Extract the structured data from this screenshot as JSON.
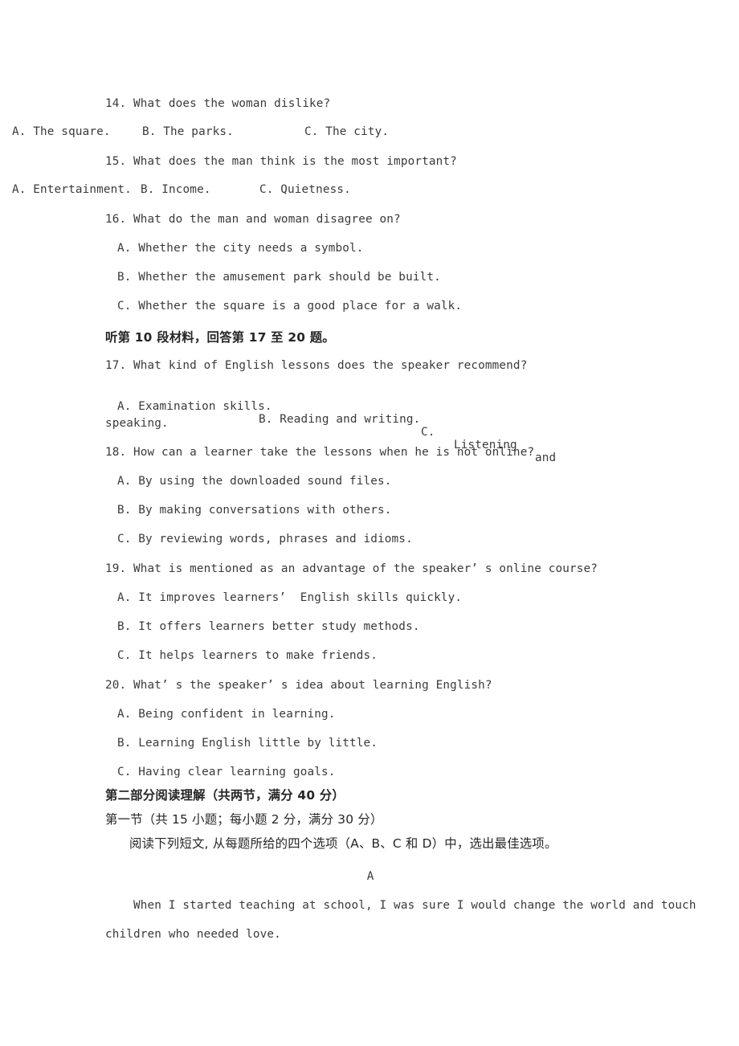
{
  "document": {
    "kind": "exam-paper-page",
    "language_mix": "english-with-chinese-headings",
    "text_color": "#3a3a3a",
    "background_color": "#ffffff"
  },
  "listening": {
    "q14": {
      "stem": "14. What does the woman dislike?",
      "options": [
        {
          "key": "A.",
          "text": "The square."
        },
        {
          "key": "B.",
          "text": "The parks."
        },
        {
          "key": "C.",
          "text": "The city."
        }
      ]
    },
    "q15": {
      "stem": "15. What does the man think is the most important?",
      "options": [
        {
          "key": "A.",
          "text": "Entertainment."
        },
        {
          "key": "B.",
          "text": "Income."
        },
        {
          "key": "C.",
          "text": "Quietness."
        }
      ]
    },
    "q16": {
      "stem": "16. What do the man and woman disagree on?",
      "options": [
        {
          "key": "A.",
          "text": "Whether the city needs a symbol."
        },
        {
          "key": "B.",
          "text": "Whether the amusement park should be built."
        },
        {
          "key": "C.",
          "text": "Whether the square is a good place for a walk."
        }
      ]
    },
    "material10_heading": "听第 10 段材料，回答第 17 至 20 题。",
    "q17": {
      "stem": "17. What kind of English lessons does the speaker recommend?",
      "option_a": "A. Examination skills.",
      "option_b": "B. Reading and writing.",
      "option_c_head": "C.",
      "option_c_word1": "Listening",
      "option_c_word2": "and",
      "option_c_wrap": "speaking."
    },
    "q18": {
      "stem": "18. How can a learner take the lessons when he is not online?",
      "options": [
        {
          "key": "A.",
          "text": "By using the downloaded sound files."
        },
        {
          "key": "B.",
          "text": "By making conversations with others."
        },
        {
          "key": "C.",
          "text": "By reviewing words, phrases and idioms."
        }
      ]
    },
    "q19": {
      "stem": "19. What is mentioned as an advantage of the speaker’ s online course?",
      "options": [
        {
          "key": "A.",
          "text": "It improves learners’  English skills quickly."
        },
        {
          "key": "B.",
          "text": "It offers learners better study methods."
        },
        {
          "key": "C.",
          "text": "It helps learners to make friends."
        }
      ]
    },
    "q20": {
      "stem": "20. What’ s the speaker’ s idea about learning English?",
      "options": [
        {
          "key": "A.",
          "text": "Being confident in learning."
        },
        {
          "key": "B.",
          "text": "Learning English little by little."
        },
        {
          "key": "C.",
          "text": "Having clear learning goals."
        }
      ]
    }
  },
  "reading": {
    "part_heading": "第二部分阅读理解（共两节，满分 40 分）",
    "section_heading": "第一节（共 15 小题；每小题 2 分，满分 30 分）",
    "instruction": "阅读下列短文, 从每题所给的四个选项（A、B、C 和 D）中，选出最佳选项。",
    "passage_label": "A",
    "passage_line1": "    When I started teaching at school, I was sure I would change the world and touch",
    "passage_line2": "children who needed love."
  }
}
